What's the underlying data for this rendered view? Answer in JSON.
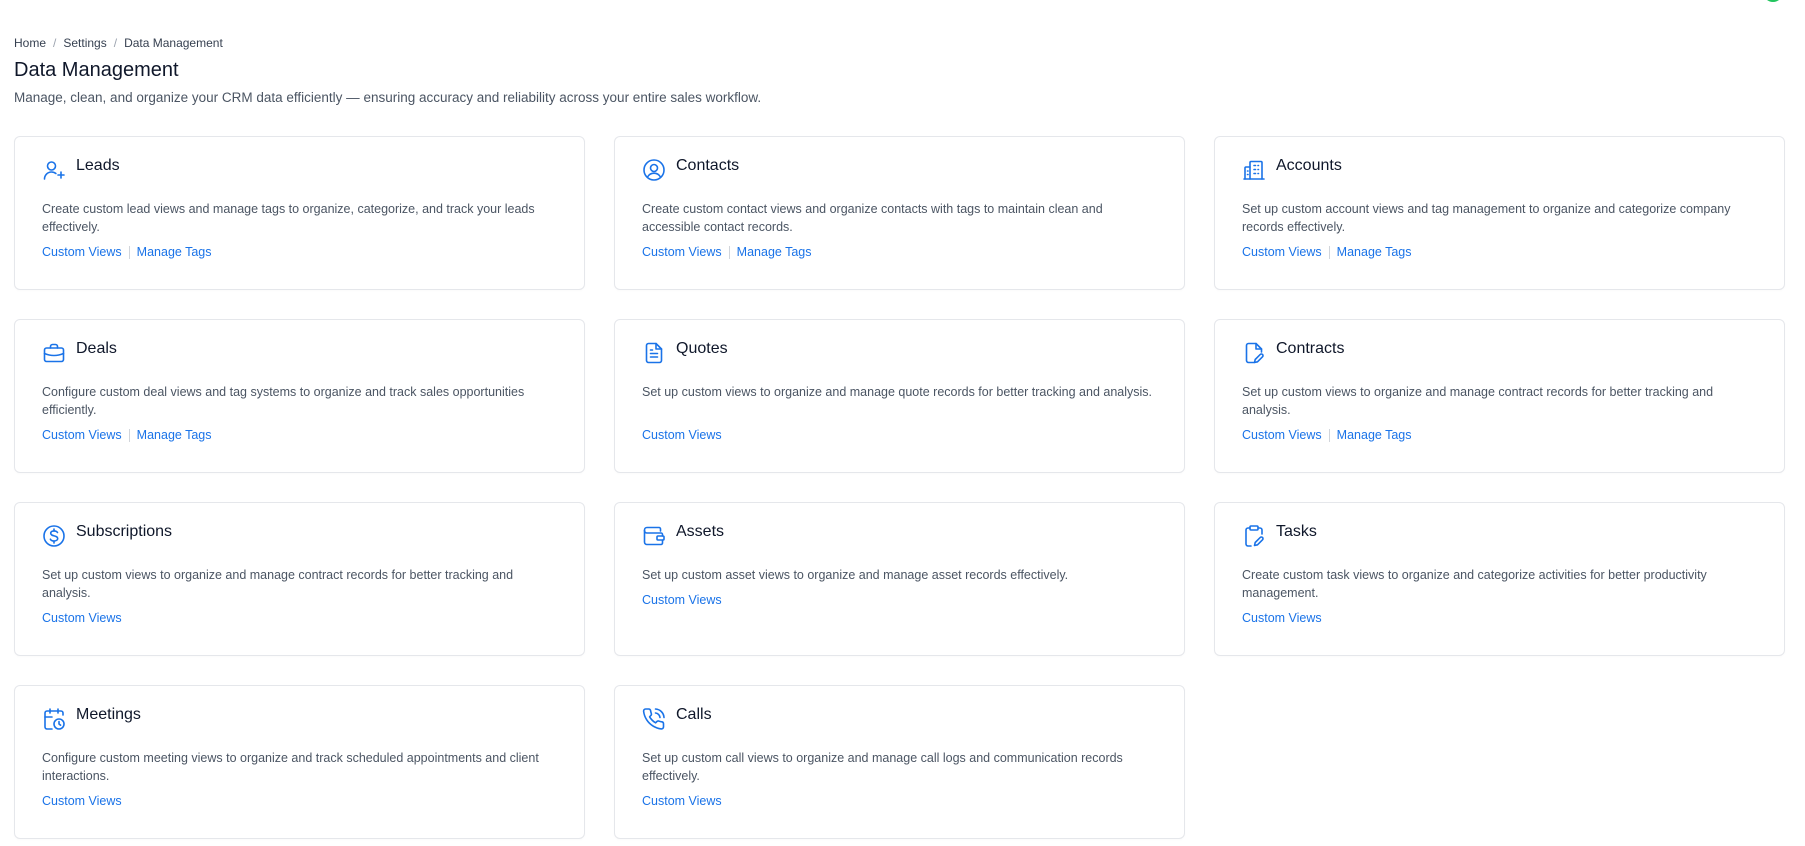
{
  "breadcrumb": {
    "home": "Home",
    "settings": "Settings",
    "current": "Data Management",
    "separator": "/"
  },
  "header": {
    "title": "Data Management",
    "subtitle": "Manage, clean, and organize your CRM data efficiently — ensuring accuracy and reliability across your entire sales workflow."
  },
  "colors": {
    "accent": "#1a73e8",
    "avatar_ring": "#22c55e"
  },
  "cards": [
    {
      "title": "Leads",
      "icon": "user-plus-icon",
      "description": "Create custom lead views and manage tags to organize, categorize, and track your leads effectively.",
      "custom_views": "Custom Views",
      "manage_tags": "Manage Tags"
    },
    {
      "title": "Contacts",
      "icon": "user-circle-icon",
      "description": "Create custom contact views and organize contacts with tags to maintain clean and accessible contact records.",
      "custom_views": "Custom Views",
      "manage_tags": "Manage Tags"
    },
    {
      "title": "Accounts",
      "icon": "building-icon",
      "description": "Set up custom account views and tag management to organize and categorize company records effectively.",
      "custom_views": "Custom Views",
      "manage_tags": "Manage Tags"
    },
    {
      "title": "Deals",
      "icon": "briefcase-icon",
      "description": "Configure custom deal views and tag systems to organize and track sales opportunities efficiently.",
      "custom_views": "Custom Views",
      "manage_tags": "Manage Tags"
    },
    {
      "title": "Quotes",
      "icon": "document-icon",
      "description": "Set up custom views to organize and manage quote records for better tracking and analysis.",
      "custom_views": "Custom Views"
    },
    {
      "title": "Contracts",
      "icon": "file-edit-icon",
      "description": "Set up custom views to organize and manage contract records for better tracking and analysis.",
      "custom_views": "Custom Views",
      "manage_tags": "Manage Tags"
    },
    {
      "title": "Subscriptions",
      "icon": "dollar-circle-icon",
      "description": "Set up custom views to organize and manage contract records for better tracking and analysis.",
      "custom_views": "Custom Views"
    },
    {
      "title": "Assets",
      "icon": "wallet-icon",
      "description": "Set up custom asset views to organize and manage asset records effectively.",
      "custom_views": "Custom Views"
    },
    {
      "title": "Tasks",
      "icon": "clipboard-edit-icon",
      "description": "Create custom task views to organize and categorize activities for better productivity management.",
      "custom_views": "Custom Views"
    },
    {
      "title": "Meetings",
      "icon": "calendar-clock-icon",
      "description": "Configure custom meeting views to organize and track scheduled appointments and client interactions.",
      "custom_views": "Custom Views"
    },
    {
      "title": "Calls",
      "icon": "phone-call-icon",
      "description": "Set up custom call views to organize and manage call logs and communication records effectively.",
      "custom_views": "Custom Views"
    }
  ]
}
